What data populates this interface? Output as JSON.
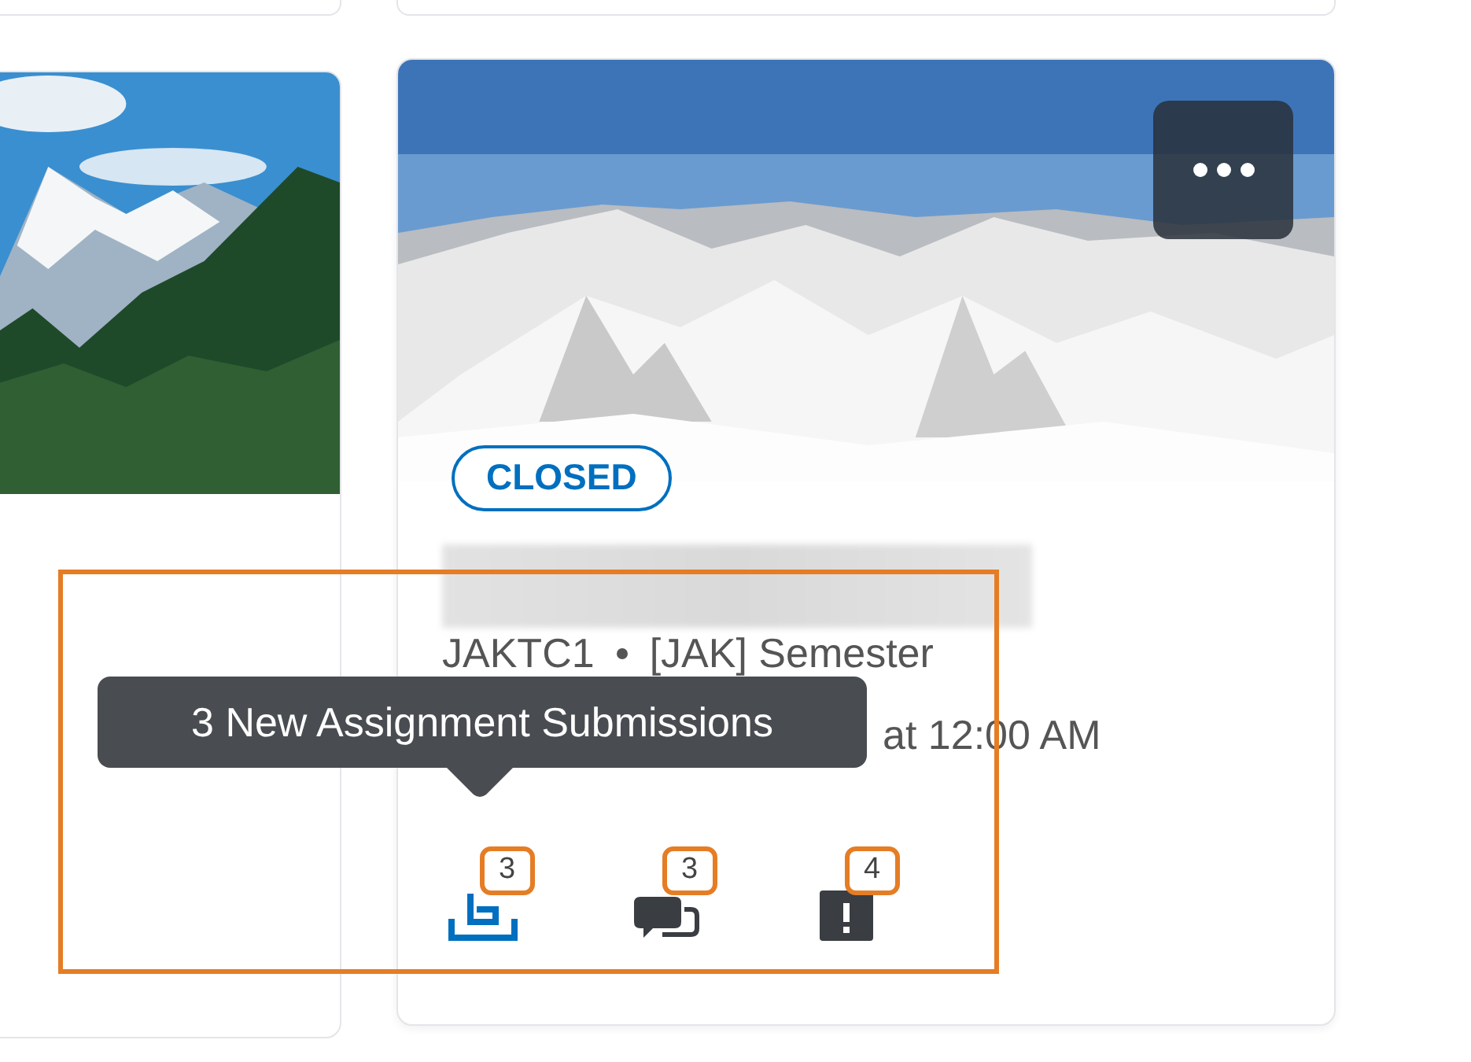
{
  "course_cards": [
    {
      "image": {
        "kind": "picture"
      }
    },
    {
      "image": {
        "kind": "picture"
      },
      "status_badge": "CLOSED",
      "title_blurred": true,
      "course_code": "JAKTC1",
      "semester": "[JAK] Semester",
      "date_line": "at 12:00 AM",
      "notifications": [
        {
          "kind": "assignments",
          "count": "3",
          "selected": true
        },
        {
          "kind": "discussions",
          "count": "3",
          "selected": false
        },
        {
          "kind": "quizzes",
          "count": "4",
          "selected": false
        }
      ]
    }
  ],
  "tooltip": "3 New Assignment Submissions"
}
